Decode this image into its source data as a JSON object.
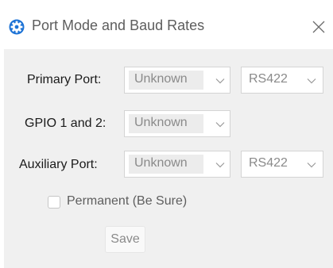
{
  "window": {
    "title": "Port Mode and Baud Rates",
    "icon": "gear-icon",
    "close_icon": "close-icon"
  },
  "rows": [
    {
      "label": "Primary Port:",
      "mode": "Unknown",
      "baud": "RS422"
    },
    {
      "label": "GPIO 1 and 2:",
      "mode": "Unknown"
    },
    {
      "label": "Auxiliary Port:",
      "mode": "Unknown",
      "baud": "RS422"
    }
  ],
  "permanent": {
    "label": "Permanent (Be Sure)",
    "checked": false
  },
  "save_button": {
    "label": "Save"
  },
  "colors": {
    "accent": "#1f74d6",
    "client_bg": "#f0f0f0",
    "disabled_text": "#8a8a8a"
  }
}
